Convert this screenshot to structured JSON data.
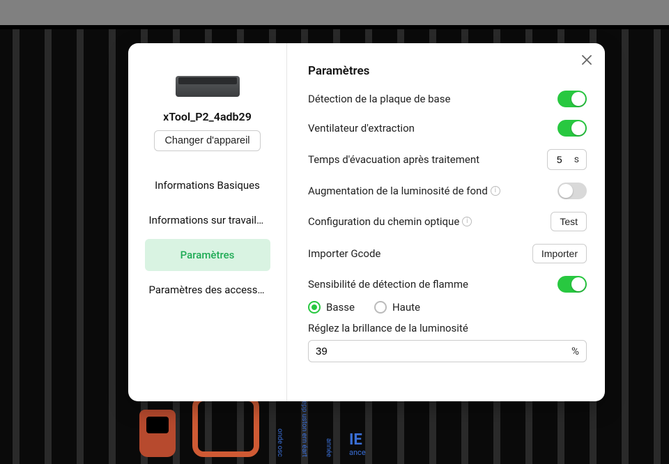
{
  "colors": {
    "accent_green": "#28c840"
  },
  "device": {
    "name": "xTool_P2_4adb29",
    "change_label": "Changer d'appareil"
  },
  "nav": {
    "items": [
      {
        "id": "info-basic",
        "label": "Informations Basiques"
      },
      {
        "id": "work-info",
        "label": "Informations sur travail en ..."
      },
      {
        "id": "settings",
        "label": "Paramètres"
      },
      {
        "id": "accessories",
        "label": "Paramètres des accessoires"
      }
    ],
    "active_id": "settings"
  },
  "content": {
    "title": "Paramètres",
    "baseplate": {
      "label": "Détection de la plaque de base",
      "on": true
    },
    "fan": {
      "label": "Ventilateur d'extraction",
      "on": true
    },
    "exhaust": {
      "label": "Temps d'évacuation après traitement",
      "value": "5",
      "unit": "s"
    },
    "brightness_boost": {
      "label": "Augmentation de la luminosité de fond",
      "on": false,
      "has_info": true
    },
    "optic": {
      "label": "Configuration du chemin optique",
      "button": "Test",
      "has_info": true
    },
    "gcode": {
      "label": "Importer Gcode",
      "button": "Importer"
    },
    "flame": {
      "label": "Sensibilité de détection de flamme",
      "on": true
    },
    "flame_level": {
      "options": [
        {
          "id": "low",
          "label": "Basse"
        },
        {
          "id": "high",
          "label": "Haute"
        }
      ],
      "selected": "low"
    },
    "brightness_adjust": {
      "label": "Réglez la brillance de la luminosité",
      "value": "39",
      "unit": "%"
    }
  },
  "bg_art": {
    "col1": "onde\nosc",
    "col2": "epp\nuston\nern\néart",
    "col3": "année",
    "big": "IE",
    "sub": "ance"
  }
}
